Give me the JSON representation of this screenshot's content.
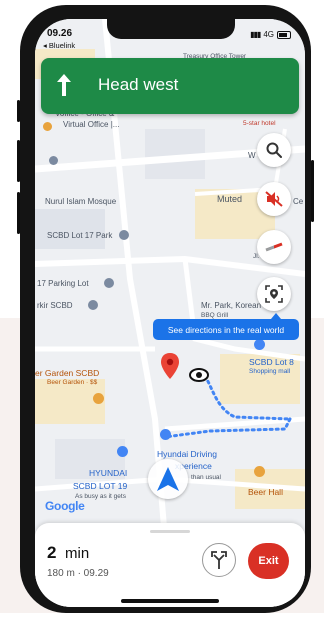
{
  "status": {
    "time": "09.26",
    "back_app": "◂ Bluelink",
    "network": "4G"
  },
  "nav_banner": {
    "instruction": "Head west"
  },
  "tooltip": {
    "text": "See directions in the real world"
  },
  "map_labels": {
    "treasury": "Treasury Office Tower",
    "virtual_office": "Virtual Office |...",
    "voffice": "Voffice - Office &",
    "hotel": "5-star hotel",
    "muted": "Muted",
    "we": "W",
    "mosque": "Nurul Islam Mosque",
    "scbd17": "SCBD Lot 17 Park",
    "parking17": "17 Parking Lot",
    "rkir": "rkir SCBD",
    "mrpark": "Mr. Park, Korean",
    "bbq": "BBQ Grill",
    "jl": "Jl. Tu",
    "garden": "er Garden SCBD",
    "garden_sub": "Beer Garden · $$",
    "scbd8": "SCBD Lot 8",
    "shopping": "Shopping mall",
    "hyundai_drv": "Hyundai Driving",
    "experience": "xperience",
    "usual": "than usual",
    "hyundai": "HYUNDAI",
    "scbd19": "SCBD LOT 19",
    "busy": "As busy as it gets",
    "beerhall": "Beer Hall",
    "ce": "Ce",
    "google": "Google"
  },
  "trip": {
    "duration_value": "2",
    "duration_unit": "min",
    "details": "180 m · 09.29",
    "exit_label": "Exit"
  },
  "icons": [
    "search-icon",
    "mute-icon",
    "compass-icon",
    "live-view-icon",
    "place-pin-icon",
    "route-options-icon",
    "navigation-arrow-icon"
  ],
  "colors": {
    "banner": "#1e8a47",
    "tooltip": "#1b73e8",
    "exit": "#d93025",
    "route": "#4285f4"
  }
}
